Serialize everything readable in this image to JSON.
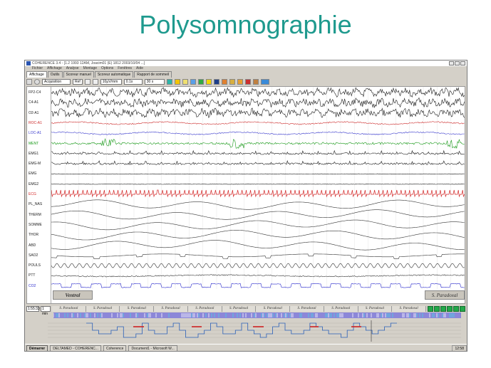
{
  "slide": {
    "title": "Polysomnographie"
  },
  "window": {
    "title": "COHERENCE 3.4 - [1.2 1993 12AM, Joacim01 (E) 1812 2003/10/04 ...]",
    "menu": [
      "Fichier",
      "Affichage",
      "Analyse",
      "Montage",
      "Options",
      "Fenêtres",
      "Aide"
    ],
    "tabs": [
      "Affichage",
      "Outils",
      "Scoreur manuel",
      "Scoreur automatique",
      "Rapport de sommeil"
    ],
    "toolbar": {
      "mode": "Acquisition",
      "ref": "Ref",
      "speed": "10μV/mm",
      "filter": "0.1s",
      "span": "30 s"
    }
  },
  "channels": [
    {
      "label": "FP2-C4",
      "color": "#1a1a1a",
      "kind": "eeg"
    },
    {
      "label": "C4-A1",
      "color": "#1a1a1a",
      "kind": "eeg"
    },
    {
      "label": "O2-A1",
      "color": "#1a1a1a",
      "kind": "eeg"
    },
    {
      "label": "ROC-A1",
      "color": "#cc2a2a",
      "kind": "eog"
    },
    {
      "label": "LOC-A1",
      "color": "#3a3acc",
      "kind": "eog"
    },
    {
      "label": "MENT",
      "color": "#1a9a1a",
      "kind": "emg"
    },
    {
      "label": "EMG1",
      "color": "#1a1a1a",
      "kind": "emgleg"
    },
    {
      "label": "EMG-M",
      "color": "#1a1a1a",
      "kind": "emgleg"
    },
    {
      "label": "EMG",
      "color": "#1a1a1a",
      "kind": "flat"
    },
    {
      "label": "EMG2",
      "color": "#1a1a1a",
      "kind": "flat"
    },
    {
      "label": "ECG",
      "color": "#d42a2a",
      "kind": "ecg"
    },
    {
      "label": "PL_NAS",
      "color": "#333333",
      "kind": "resp"
    },
    {
      "label": "THERM",
      "color": "#333333",
      "kind": "resp"
    },
    {
      "label": "SOMME",
      "color": "#333333",
      "kind": "resp"
    },
    {
      "label": "THOR",
      "color": "#333333",
      "kind": "resp"
    },
    {
      "label": "ABD",
      "color": "#333333",
      "kind": "resp"
    },
    {
      "label": "SAO2",
      "color": "#333333",
      "kind": "sao2"
    },
    {
      "label": "POULS",
      "color": "#333333",
      "kind": "pulse"
    },
    {
      "label": "PTT",
      "color": "#333333",
      "kind": "ptt"
    },
    {
      "label": "CO2",
      "color": "#2a2acc",
      "kind": "co2"
    }
  ],
  "stages": {
    "left": "Ventral",
    "right": "S. Paradoxal"
  },
  "epochs": {
    "current": "1:55:33",
    "zoom": "1 min",
    "labels": [
      "S. Paradoxal",
      "S. Paradoxal",
      "S. Paradoxal",
      "S. Paradoxal",
      "S. Paradoxal",
      "S. Paradoxal",
      "S. Paradoxal",
      "S. Paradoxal",
      "S. Paradoxal",
      "S. Paradoxal",
      "S. Paradoxal"
    ]
  },
  "taskbar": {
    "start": "Démarrer",
    "tasks": [
      "DELTAMED - COHERENC...",
      "Coherence",
      "Document1 - Microsoft W..."
    ],
    "clock": "12:58"
  },
  "colors": {
    "title": "#1f9a8e",
    "hypnoBar": "#8c87d8",
    "hypnoLine": "#2a5fb8",
    "navButton": "#22a84a"
  }
}
